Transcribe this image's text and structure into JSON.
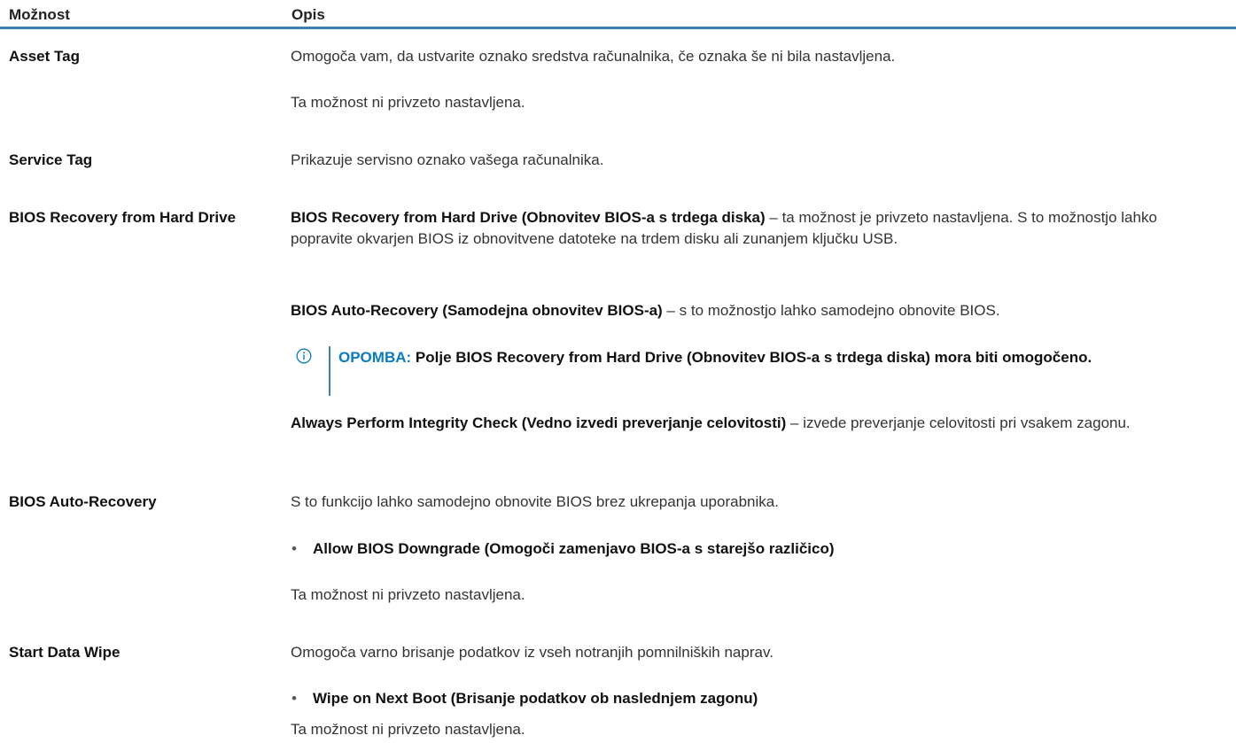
{
  "header": {
    "col_option": "Možnost",
    "col_desc": "Opis"
  },
  "rows": [
    {
      "option": "Asset Tag",
      "p1": "Omogoča vam, da ustvarite oznako sredstva računalnika, če oznaka še ni bila nastavljena.",
      "p2": "Ta možnost ni privzeto nastavljena."
    },
    {
      "option": "Service Tag",
      "p1": "Prikazuje servisno oznako vašega računalnika."
    },
    {
      "option": "BIOS Recovery from Hard Drive",
      "p1_bold": "BIOS Recovery from Hard Drive (Obnovitev BIOS-a s trdega diska)",
      "p1_rest": " – ta možnost je privzeto nastavljena. S to možnostjo lahko popravite okvarjen BIOS iz obnovitvene datoteke na trdem disku ali zunanjem ključku USB.",
      "p2_bold": "BIOS Auto-Recovery (Samodejna obnovitev BIOS-a)",
      "p2_rest": " – s to možnostjo lahko samodejno obnovite BIOS.",
      "note_label": "OPOMBA:",
      "note_text": " Polje BIOS Recovery from Hard Drive (Obnovitev BIOS-a s trdega diska) mora biti omogočeno.",
      "p3_bold": "Always Perform Integrity Check (Vedno izvedi preverjanje celovitosti)",
      "p3_rest": " – izvede preverjanje celovitosti pri vsakem zagonu."
    },
    {
      "option": "BIOS Auto-Recovery",
      "p1": "S to funkcijo lahko samodejno obnovite BIOS brez ukrepanja uporabnika.",
      "bullet": "Allow BIOS Downgrade (Omogoči zamenjavo BIOS-a s starejšo različico)",
      "p2": "Ta možnost ni privzeto nastavljena."
    },
    {
      "option": "Start Data Wipe",
      "p1": "Omogoča varno brisanje podatkov iz vseh notranjih pomnilniških naprav.",
      "bullet": "Wipe on Next Boot (Brisanje podatkov ob naslednjem zagonu)",
      "p2": "Ta možnost ni privzeto nastavljena."
    }
  ],
  "bullet_char": "•",
  "note_icon": "info-icon"
}
